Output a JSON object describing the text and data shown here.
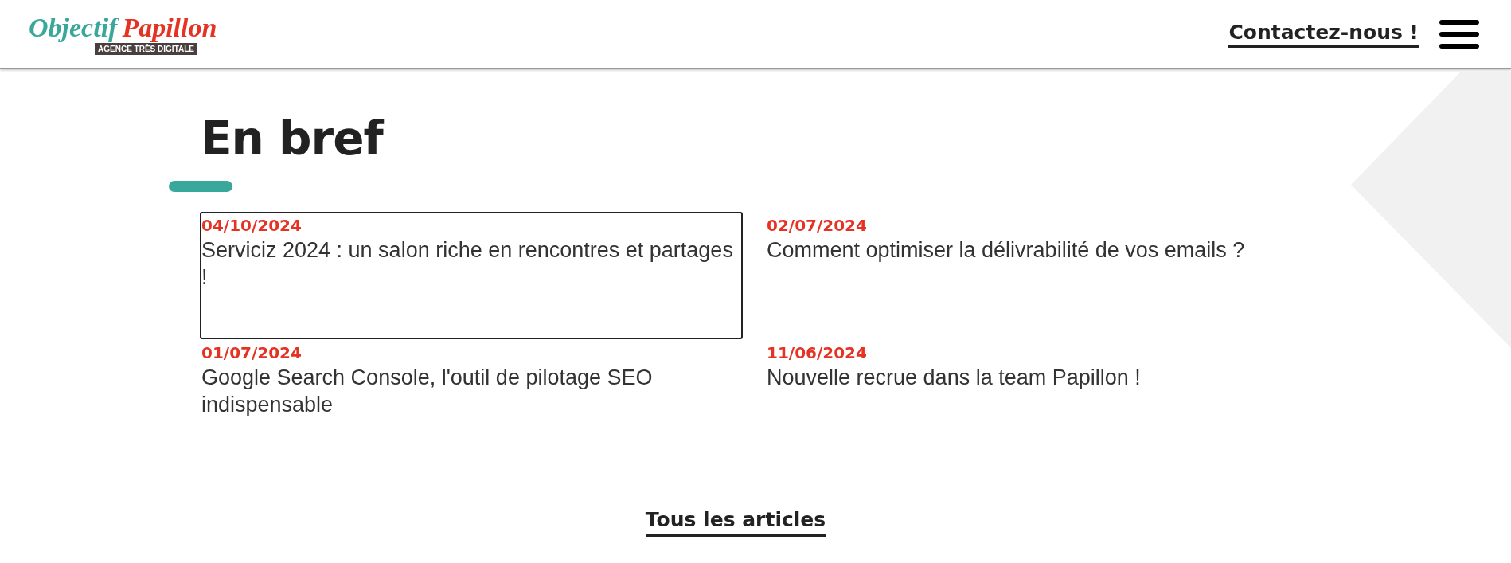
{
  "header": {
    "logo": {
      "first_word": "Objectif",
      "second_word": "Papillon",
      "tagline": "AGENCE TRÈS DIGITALE"
    },
    "contact_link": "Contactez-nous !"
  },
  "section": {
    "title": "En bref",
    "articles": [
      {
        "date": "04/10/2024",
        "title": "Serviciz 2024 : un salon riche en rencontres et partages !",
        "focused": true
      },
      {
        "date": "02/07/2024",
        "title": "Comment optimiser la délivrabilité de vos emails ?",
        "focused": false
      },
      {
        "date": "01/07/2024",
        "title": "Google Search Console, l'outil de pilotage SEO indispensable",
        "focused": false
      },
      {
        "date": "11/06/2024",
        "title": "Nouvelle recrue dans la team Papillon !",
        "focused": false
      }
    ],
    "all_link": "Tous les articles"
  }
}
